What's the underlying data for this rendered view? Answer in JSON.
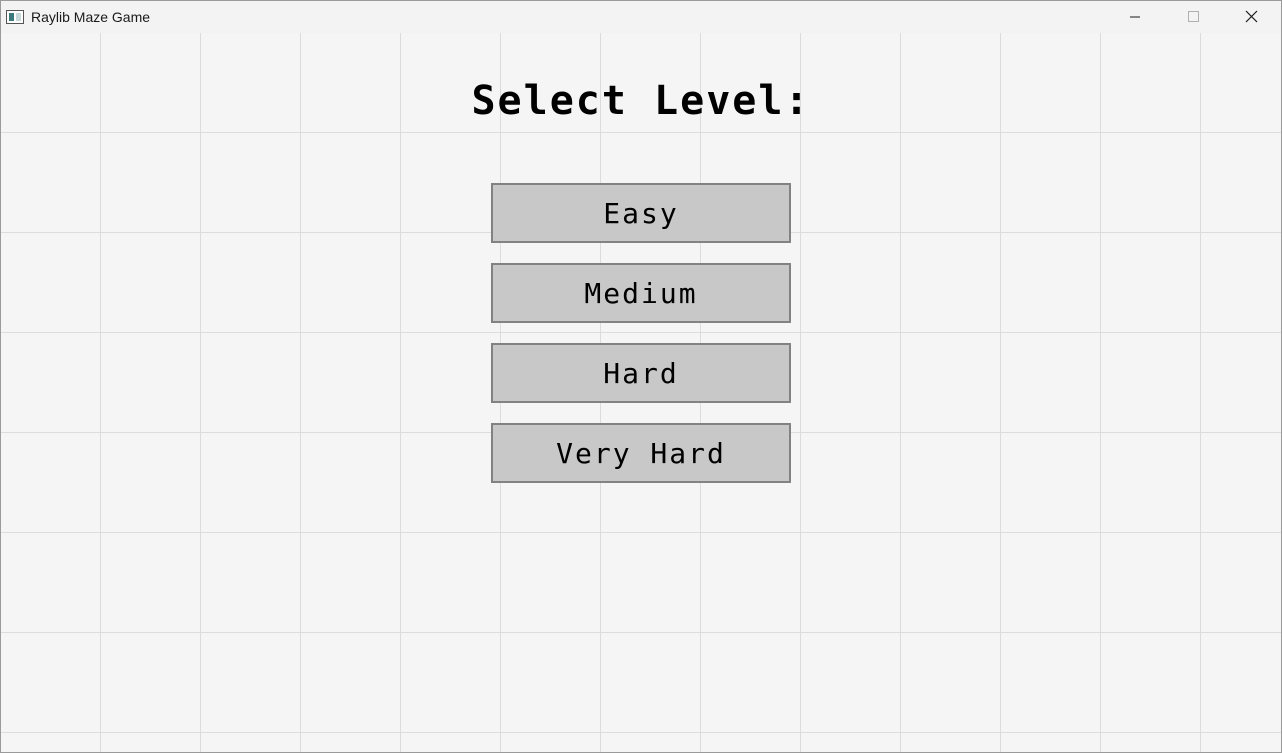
{
  "window": {
    "title": "Raylib Maze Game",
    "icon": "app-window-icon"
  },
  "controls": {
    "minimize_icon": "minimize-icon",
    "maximize_icon": "maximize-icon",
    "close_icon": "close-icon"
  },
  "menu": {
    "heading": "Select Level:",
    "levels": [
      {
        "label": "Easy"
      },
      {
        "label": "Medium"
      },
      {
        "label": "Hard"
      },
      {
        "label": "Very Hard"
      }
    ]
  },
  "colors": {
    "background": "#f5f5f5",
    "grid": "#dcdcdc",
    "button_fill": "#c8c8c8",
    "button_border": "#828282",
    "text": "#000000"
  }
}
